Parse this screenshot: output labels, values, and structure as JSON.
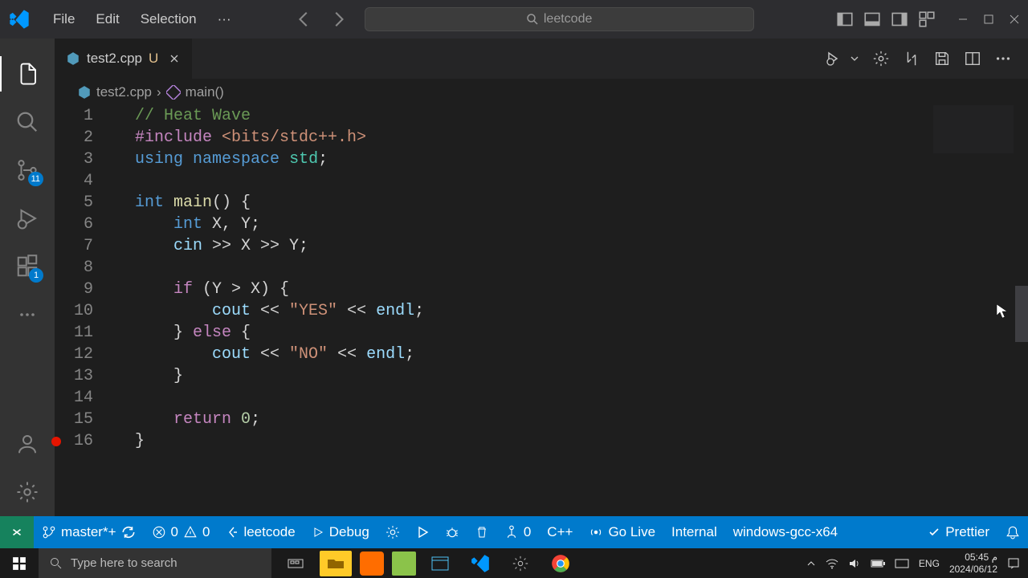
{
  "menu": {
    "file": "File",
    "edit": "Edit",
    "selection": "Selection",
    "more": "···"
  },
  "search": {
    "placeholder": "leetcode"
  },
  "tab": {
    "filename": "test2.cpp",
    "modified_indicator": "U"
  },
  "breadcrumb": {
    "file": "test2.cpp",
    "symbol": "main()"
  },
  "activity": {
    "scm_badge": "11",
    "ext_badge": "1"
  },
  "gutter": {
    "lines": [
      "1",
      "2",
      "3",
      "4",
      "5",
      "6",
      "7",
      "8",
      "9",
      "10",
      "11",
      "12",
      "13",
      "14",
      "15",
      "16"
    ]
  },
  "code": {
    "l1": "// Heat Wave",
    "l2a": "#include",
    "l2b": "<bits/stdc++.h>",
    "l3a": "using",
    "l3b": "namespace",
    "l3c": "std",
    "l5a": "int",
    "l5b": "main",
    "l5c": "() {",
    "l6a": "int",
    "l6b": " X, Y;",
    "l7a": "cin",
    "l7b": " >> X >> Y;",
    "l9a": "if",
    "l9b": " (Y > X) {",
    "l10a": "cout",
    "l10b": " << ",
    "l10c": "\"YES\"",
    "l10d": " << ",
    "l10e": "endl",
    "l10f": ";",
    "l11a": "} ",
    "l11b": "else",
    "l11c": " {",
    "l12a": "cout",
    "l12b": " << ",
    "l12c": "\"NO\"",
    "l12d": " << ",
    "l12e": "endl",
    "l12f": ";",
    "l13": "}",
    "l15a": "return",
    "l15b": " ",
    "l15c": "0",
    "l15d": ";",
    "l16": "}"
  },
  "status": {
    "branch": "master*+",
    "errors": "0",
    "warnings": "0",
    "leetcode": "leetcode",
    "debug": "Debug",
    "ports": "0",
    "lang": "C++",
    "golive": "Go Live",
    "internal": "Internal",
    "compiler": "windows-gcc-x64",
    "prettier": "Prettier"
  },
  "taskbar": {
    "search": "Type here to search",
    "lang": "ENG",
    "time": "05:45 م",
    "date": "2024/06/12"
  }
}
